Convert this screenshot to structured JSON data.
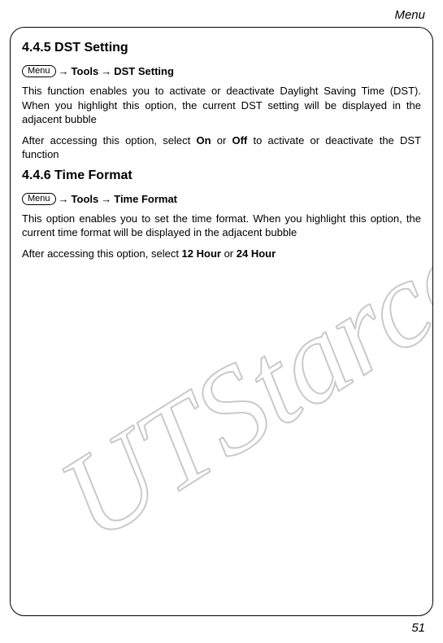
{
  "header": "Menu",
  "page_number": "51",
  "watermark_text": "UTStarcom",
  "menu_button_label": "Menu",
  "arrow": "→",
  "sections": {
    "s1": {
      "heading": "4.4.5 DST Setting",
      "path_tools": "Tools",
      "path_item": "DST Setting",
      "p1": "This function enables you to activate or deactivate Daylight Saving Time (DST). When you highlight this option, the current DST setting will be displayed in the adjacent bubble",
      "p2_a": "After accessing this option, select ",
      "p2_on": "On",
      "p2_mid": " or ",
      "p2_off": "Off",
      "p2_b": " to activate or deactivate the DST function"
    },
    "s2": {
      "heading": "4.4.6 Time Format",
      "path_tools": "Tools",
      "path_item": "Time Format",
      "p1": "This option enables you to set the time format. When you highlight this option, the current time format will be displayed in the adjacent bubble",
      "p2_a": "After accessing this option, select ",
      "p2_12": "12 Hour",
      "p2_mid": " or ",
      "p2_24": "24 Hour"
    }
  }
}
